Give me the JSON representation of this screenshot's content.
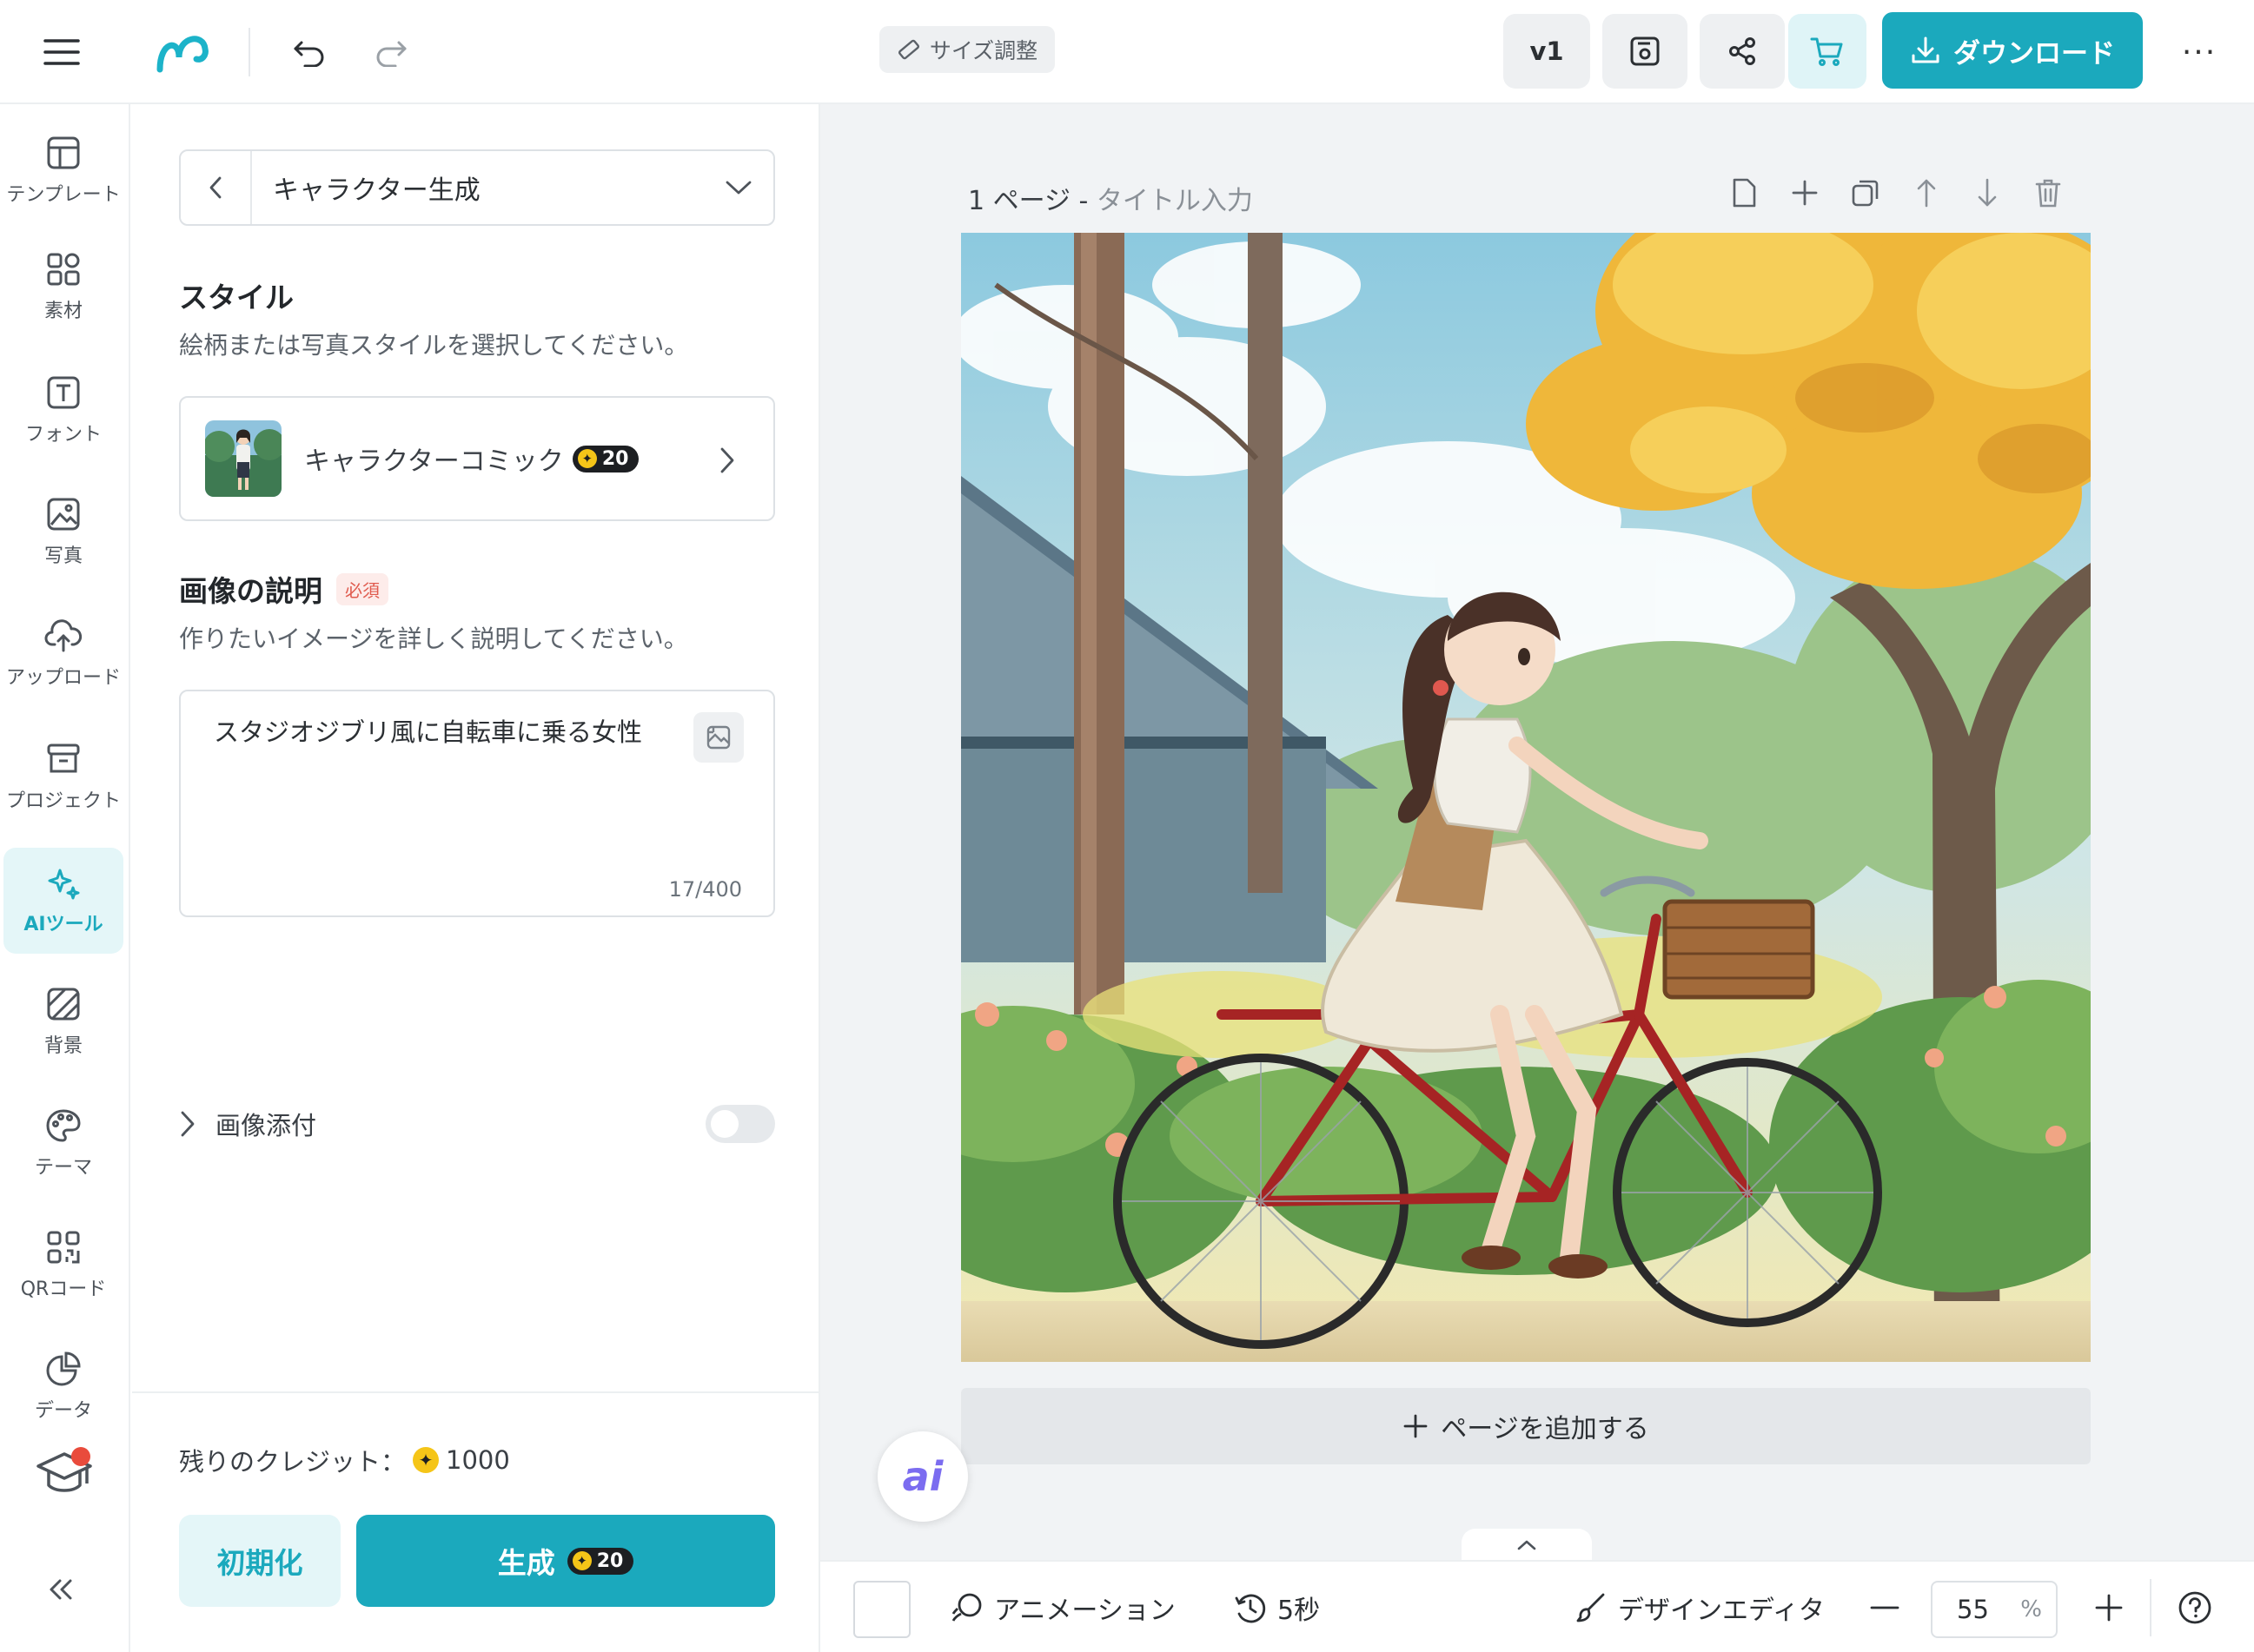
{
  "app": {
    "brand_color": "#1ba9bd"
  },
  "topbar": {
    "resize_label": "サイズ調整",
    "version_label": "v1",
    "download_label": "ダウンロード",
    "more_label": "···"
  },
  "rail": {
    "items": [
      {
        "label": "テンプレート",
        "icon": "template-icon"
      },
      {
        "label": "素材",
        "icon": "elements-icon"
      },
      {
        "label": "フォント",
        "icon": "font-icon"
      },
      {
        "label": "写真",
        "icon": "photo-icon"
      },
      {
        "label": "アップロード",
        "icon": "upload-icon"
      },
      {
        "label": "プロジェクト",
        "icon": "project-icon"
      },
      {
        "label": "AIツール",
        "icon": "ai-sparkle-icon"
      },
      {
        "label": "背景",
        "icon": "background-icon"
      },
      {
        "label": "テーマ",
        "icon": "palette-icon"
      },
      {
        "label": "QRコード",
        "icon": "qr-icon"
      },
      {
        "label": "データ",
        "icon": "chart-icon"
      }
    ]
  },
  "panel": {
    "selector_title": "キャラクター生成",
    "style_title": "スタイル",
    "style_subtitle": "絵柄または写真スタイルを選択してください。",
    "style_name": "キャラクターコミック",
    "style_cost": "20",
    "desc_title": "画像の説明",
    "required_label": "必須",
    "desc_subtitle": "作りたいイメージを詳しく説明してください。",
    "prompt_value": "スタジオジブリ風に自転車に乗る女性",
    "char_count": "17/400",
    "attach_label": "画像添付",
    "attach_enabled": false,
    "credits_label": "残りのクレジット：",
    "credits_value": "1000",
    "reset_label": "初期化",
    "generate_label": "生成",
    "generate_cost": "20"
  },
  "canvas": {
    "page_number": "1 ページ - ",
    "page_title_placeholder": "タイトル入力",
    "add_page_label": "ページを追加する",
    "ai_fab_label": "ai"
  },
  "bottombar": {
    "animation_label": "アニメーション",
    "duration_label": "5秒",
    "design_editor_label": "デザインエディタ",
    "zoom_value": "55",
    "zoom_unit": "%"
  }
}
